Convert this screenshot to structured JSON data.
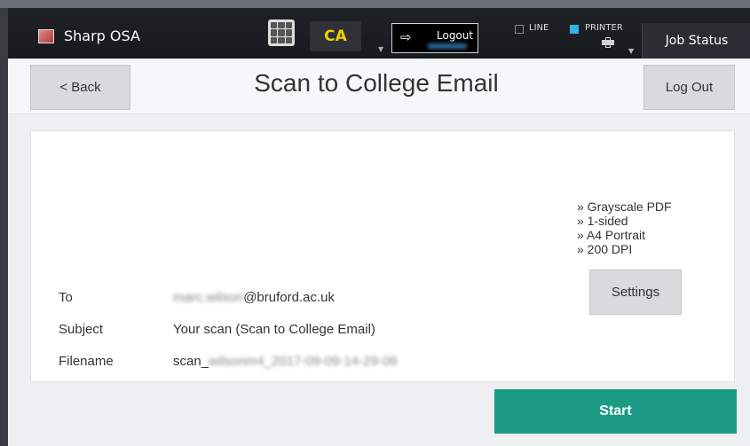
{
  "system_bar": {
    "app_name": "Sharp OSA",
    "ca_label": "CA",
    "logout_label": "Logout",
    "line_label": "LINE",
    "printer_label": "PRINTER",
    "job_status_label": "Job Status",
    "line_checked": false,
    "printer_checked": true,
    "accent_printer": "#2db3e8",
    "accent_ca": "#f2d000"
  },
  "header": {
    "back_label": "< Back",
    "title": "Scan to College Email",
    "logout_label": "Log Out"
  },
  "form": {
    "to_label": "To",
    "to_user_blurred": "marc.wilson",
    "to_domain": "@bruford.ac.uk",
    "subject_label": "Subject",
    "subject_value": "Your scan (Scan to College Email)",
    "filename_label": "Filename",
    "filename_prefix": "scan_",
    "filename_rest_blurred": "wilsonm4_2017-09-09-14-29-06"
  },
  "summary": {
    "lines": [
      "» Grayscale PDF",
      "» 1-sided",
      "» A4 Portrait",
      "» 200 DPI"
    ],
    "settings_label": "Settings"
  },
  "actions": {
    "start_label": "Start",
    "start_color": "#1b9b86"
  }
}
